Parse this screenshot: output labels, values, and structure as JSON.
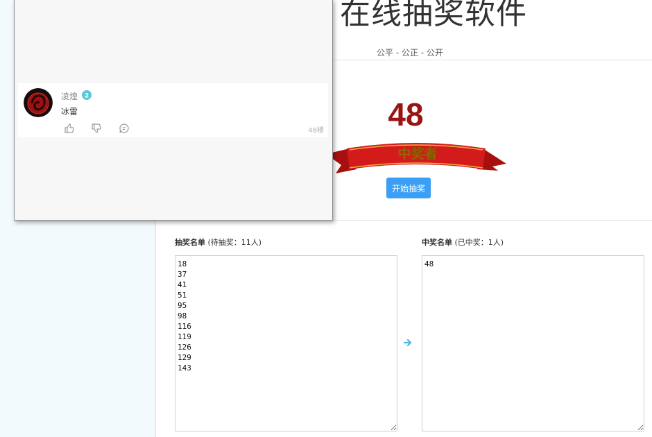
{
  "app": {
    "title": "在线抽奖软件",
    "subtitle": "公平 - 公正 - 公开"
  },
  "draw": {
    "winner_number": "48",
    "ribbon_text": "中奖者",
    "start_button": "开始抽奖"
  },
  "pool": {
    "label": "抽奖名单",
    "status": " (待抽奖：11人)",
    "entries": "18\n37\n41\n51\n95\n98\n116\n119\n126\n129\n143"
  },
  "winners": {
    "label": "中奖名单",
    "status": " (已中奖：1人)",
    "entries": "48"
  },
  "comment": {
    "username": "凌煌",
    "level": "2",
    "text": "冰雷",
    "floor": "48楼"
  },
  "colors": {
    "accent_blue": "#3a9ff5",
    "winner_red": "#9a1414",
    "ribbon_red": "#d31b1b",
    "ribbon_gold": "#f7d25a",
    "badge_teal": "#5ac8d8"
  }
}
